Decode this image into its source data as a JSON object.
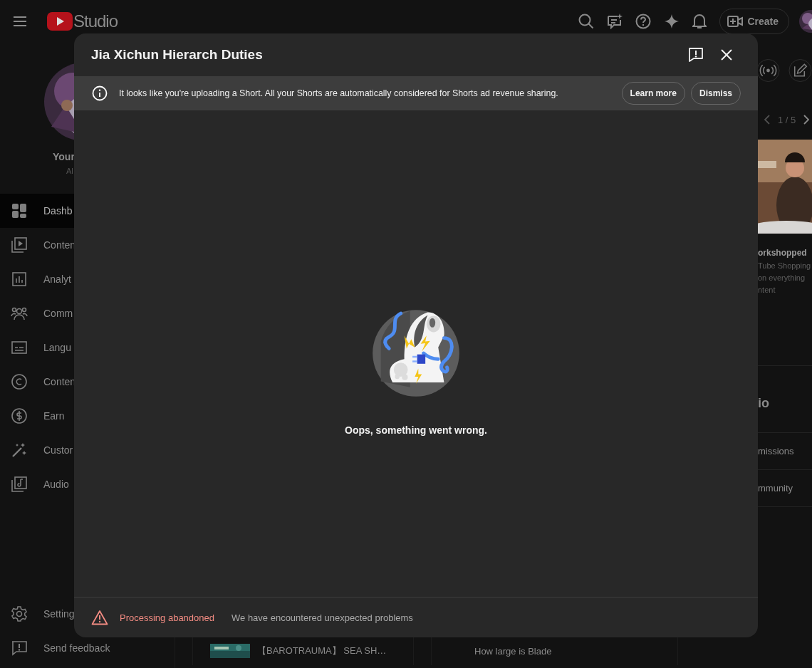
{
  "app_bar": {
    "logo": "Studio",
    "create_label": "Create"
  },
  "sidebar": {
    "channel_name": "Your",
    "channel_subtitle": "Al",
    "items": [
      {
        "label": "Dashb",
        "selected": true
      },
      {
        "label": "Conten",
        "selected": false
      },
      {
        "label": "Analyt",
        "selected": false
      },
      {
        "label": "Comm",
        "selected": false
      },
      {
        "label": "Langu",
        "selected": false
      },
      {
        "label": "Conten",
        "selected": false
      },
      {
        "label": "Earn",
        "selected": false
      },
      {
        "label": "Custor",
        "selected": false
      },
      {
        "label": "Audio",
        "selected": false
      }
    ],
    "footer_items": [
      "Setting",
      "Send feedback"
    ]
  },
  "right_panel": {
    "pager": "1 / 5",
    "card_title": "orkshopped",
    "card_lines": [
      "Tube Shopping",
      "on everything",
      "ntent"
    ],
    "section_title": "io",
    "links": [
      "missions",
      "mmunity"
    ]
  },
  "bottom_cards": [
    {
      "title": "【BAROTRAUMA】 SEA SH…"
    },
    {
      "title": "How large is Blade"
    }
  ],
  "dialog": {
    "title": "Jia Xichun Hierarch Duties",
    "notice": {
      "text": "It looks like you're uploading a Short. All your Shorts are automatically considered for Shorts ad revenue sharing.",
      "buttons": [
        "Learn more",
        "Dismiss"
      ]
    },
    "error_message": "Oops, something went wrong.",
    "status": {
      "kind": "error",
      "label": "Processing abandoned",
      "message": "We have encountered unexpected problems"
    }
  }
}
